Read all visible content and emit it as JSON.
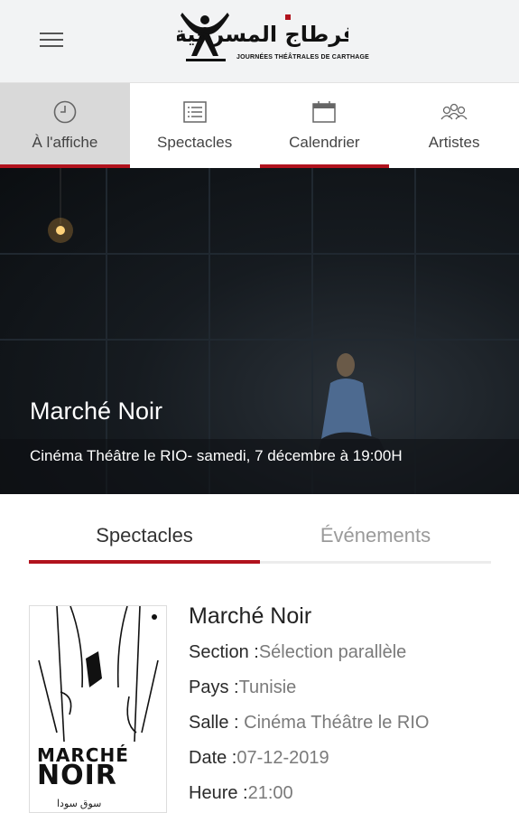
{
  "header": {
    "logo_arabic": "أيام قرطاج المسرحية",
    "logo_subtitle": "JOURNÉES THÉÂTRALES DE CARTHAGE",
    "menu_icon": "hamburger-icon",
    "logo_icon": "jtc-logo"
  },
  "nav": [
    {
      "label": "À l'affiche",
      "icon": "clock-icon",
      "active": true
    },
    {
      "label": "Spectacles",
      "icon": "list-icon",
      "active": false
    },
    {
      "label": "Calendrier",
      "icon": "calendar-icon",
      "active": false
    },
    {
      "label": "Artistes",
      "icon": "artists-icon",
      "active": false
    }
  ],
  "hero": {
    "title": "Marché Noir",
    "subtitle": "Cinéma Théâtre le RIO- samedi, 7 décembre à 19:00H"
  },
  "tabs": [
    {
      "label": "Spectacles",
      "active": true
    },
    {
      "label": "Événements",
      "active": false
    }
  ],
  "show": {
    "title": "Marché Noir",
    "poster": {
      "line1": "MARCHÉ",
      "line2": "NOIR",
      "arabic": "سوق سودا"
    },
    "fields": [
      {
        "key": "Section :",
        "value": "Sélection parallèle"
      },
      {
        "key": "Pays :",
        "value": "Tunisie"
      },
      {
        "key": "Salle : ",
        "value": "Cinéma Théâtre le RIO"
      },
      {
        "key": "Date :",
        "value": "07-12-2019"
      },
      {
        "key": "Heure :",
        "value": "21:00"
      }
    ]
  },
  "colors": {
    "accent": "#b1121d",
    "header_bg": "#f2f3f4",
    "active_tab_bg": "#d9d9d9"
  }
}
